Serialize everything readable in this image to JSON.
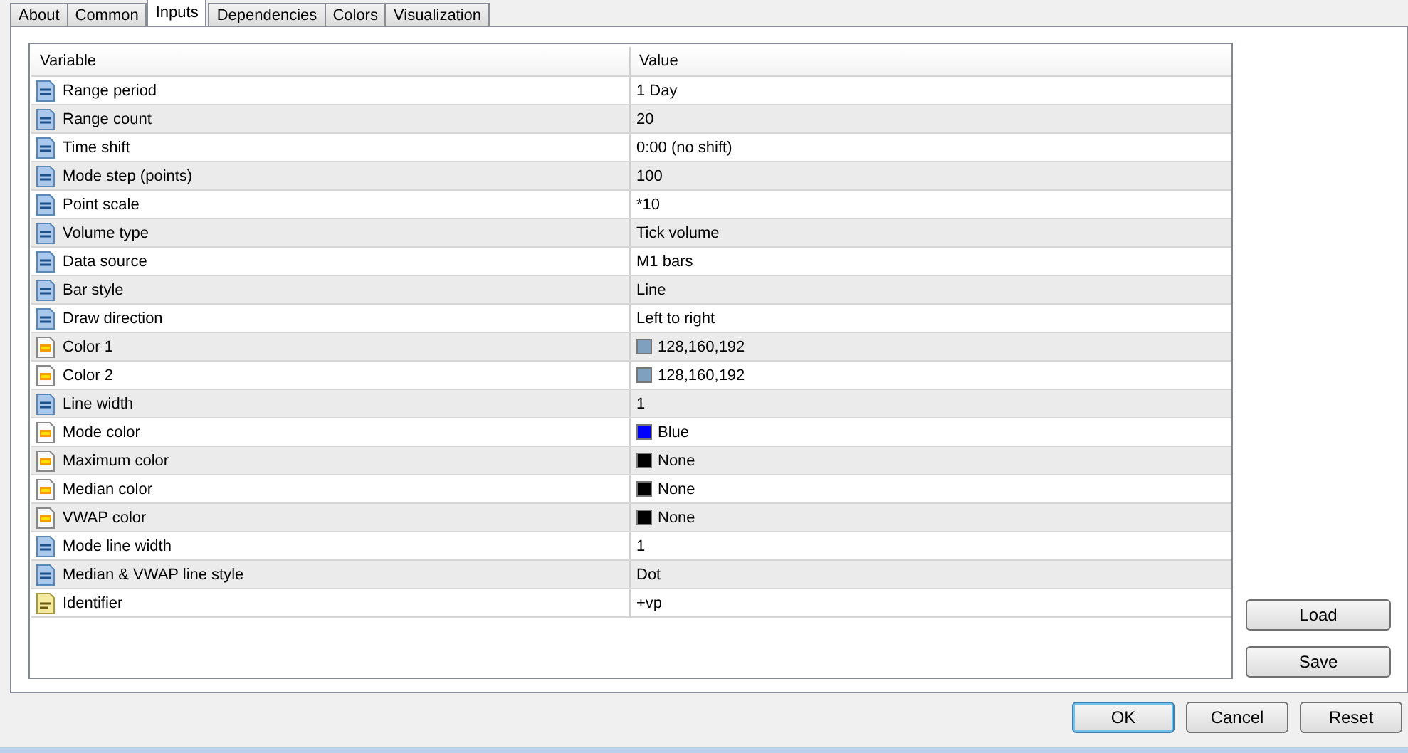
{
  "tabs": [
    {
      "label": "About",
      "selected": false
    },
    {
      "label": "Common",
      "selected": false
    },
    {
      "label": "Inputs",
      "selected": true
    },
    {
      "label": "Dependencies",
      "selected": false
    },
    {
      "label": "Colors",
      "selected": false
    },
    {
      "label": "Visualization",
      "selected": false
    }
  ],
  "table": {
    "columns": [
      "Variable",
      "Value"
    ],
    "rows": [
      {
        "kind": "number",
        "variable": "Range period",
        "value": "1 Day"
      },
      {
        "kind": "number",
        "variable": "Range count",
        "value": "20"
      },
      {
        "kind": "number",
        "variable": "Time shift",
        "value": "0:00 (no shift)"
      },
      {
        "kind": "number",
        "variable": "Mode step (points)",
        "value": "100"
      },
      {
        "kind": "number",
        "variable": "Point scale",
        "value": "*10"
      },
      {
        "kind": "number",
        "variable": "Volume type",
        "value": "Tick volume"
      },
      {
        "kind": "number",
        "variable": "Data source",
        "value": "M1 bars"
      },
      {
        "kind": "number",
        "variable": "Bar style",
        "value": "Line"
      },
      {
        "kind": "number",
        "variable": "Draw direction",
        "value": "Left to right"
      },
      {
        "kind": "color",
        "variable": "Color 1",
        "value": "128,160,192",
        "color": "#80a0c0"
      },
      {
        "kind": "color",
        "variable": "Color 2",
        "value": "128,160,192",
        "color": "#80a0c0"
      },
      {
        "kind": "number",
        "variable": "Line width",
        "value": "1"
      },
      {
        "kind": "color",
        "variable": "Mode color",
        "value": "Blue",
        "color": "#0000ff"
      },
      {
        "kind": "color",
        "variable": "Maximum color",
        "value": "None",
        "color": "#000000"
      },
      {
        "kind": "color",
        "variable": "Median color",
        "value": "None",
        "color": "#000000"
      },
      {
        "kind": "color",
        "variable": "VWAP color",
        "value": "None",
        "color": "#000000"
      },
      {
        "kind": "number",
        "variable": "Mode line width",
        "value": "1"
      },
      {
        "kind": "number",
        "variable": "Median & VWAP line style",
        "value": "Dot"
      },
      {
        "kind": "string",
        "variable": "Identifier",
        "value": "+vp"
      }
    ]
  },
  "side_buttons": [
    "Load",
    "Save"
  ],
  "buttons": [
    "OK",
    "Cancel",
    "Reset"
  ]
}
